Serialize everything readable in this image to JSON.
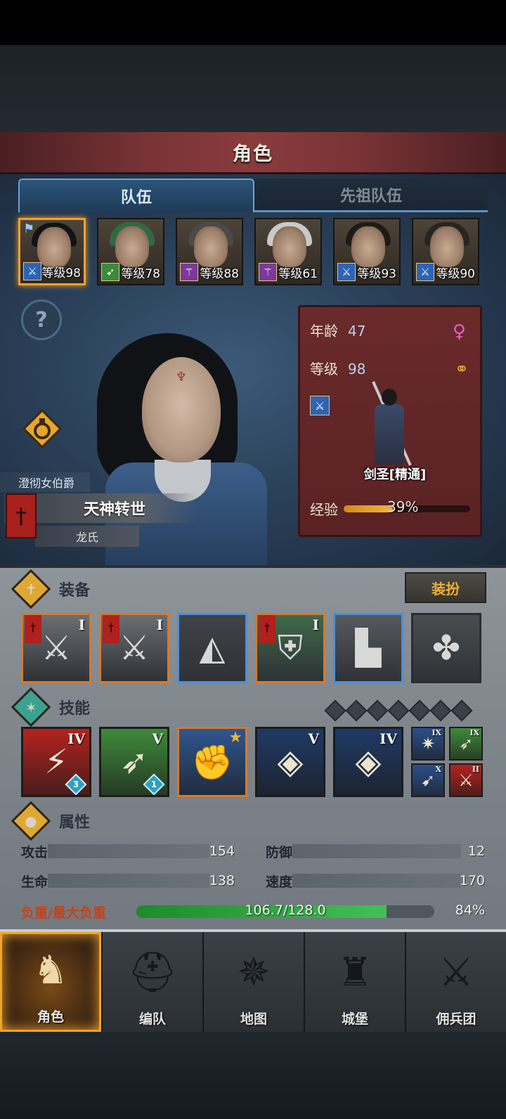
{
  "header": {
    "title": "角色"
  },
  "tabs": [
    {
      "label": "队伍",
      "active": true
    },
    {
      "label": "先祖队伍",
      "active": false
    }
  ],
  "party": [
    {
      "level": "等级98",
      "class_icon": "sword-class-icon",
      "class_color": "#2c64b5",
      "hair": "#121316",
      "selected": true
    },
    {
      "level": "等级78",
      "class_icon": "bow-class-icon",
      "class_color": "#3a8a3a",
      "hair": "#2f6a45",
      "selected": false
    },
    {
      "level": "等级88",
      "class_icon": "staff-class-icon",
      "class_color": "#7a3a9a",
      "hair": "#4a4a48",
      "selected": false
    },
    {
      "level": "等级61",
      "class_icon": "staff-class-icon",
      "class_color": "#7a3a9a",
      "hair": "#c9c9c9",
      "selected": false
    },
    {
      "level": "等级93",
      "class_icon": "sword-class-icon",
      "class_color": "#2c64b5",
      "hair": "#1e1a18",
      "selected": false
    },
    {
      "level": "等级90",
      "class_icon": "sword-class-icon",
      "class_color": "#2c64b5",
      "hair": "#2a2420",
      "selected": false
    }
  ],
  "character": {
    "title_small": "澄彻女伯爵",
    "title_main": "天神转世",
    "title_sub": "龙氏",
    "age_label": "年龄",
    "age": "47",
    "level_label": "等级",
    "level": "98",
    "class_name": "剑圣[精通]",
    "exp_label": "经验",
    "exp_percent_text": "39%",
    "exp_fraction": 0.39
  },
  "equipment": {
    "label": "装备",
    "dress_button": "装扮",
    "slots": [
      {
        "name": "halberd-weapon",
        "tier": "I",
        "banner": true,
        "rarity": "orange",
        "glyph": "⚔",
        "bg": "#6b6f74"
      },
      {
        "name": "halberd-weapon",
        "tier": "I",
        "banner": true,
        "rarity": "orange",
        "glyph": "⚔",
        "bg": "#6b6f74"
      },
      {
        "name": "hood-armor",
        "tier": "",
        "banner": false,
        "rarity": "blue",
        "glyph": "◭",
        "bg": "#3f4347"
      },
      {
        "name": "chest-armor",
        "tier": "I",
        "banner": true,
        "rarity": "orange",
        "glyph": "⛨",
        "bg": "#3e6a4a"
      },
      {
        "name": "boots-armor",
        "tier": "",
        "banner": false,
        "rarity": "blue",
        "glyph": "▙",
        "bg": "#565a5e"
      },
      {
        "name": "knot-accessory",
        "tier": "",
        "banner": false,
        "rarity": "gray",
        "glyph": "✤",
        "bg": "#4a4d50"
      }
    ]
  },
  "skills": {
    "label": "技能",
    "main": [
      {
        "tier": "IV",
        "badge": "3",
        "star": false,
        "bg": "#b4231e",
        "glyph": "⚡",
        "orange": false
      },
      {
        "tier": "V",
        "badge": "1",
        "star": false,
        "bg": "#3f8a3a",
        "glyph": "➶",
        "orange": false
      },
      {
        "tier": "",
        "badge": "",
        "star": true,
        "bg": "#2f5690",
        "glyph": "✊",
        "orange": true
      },
      {
        "tier": "V",
        "badge": "",
        "star": false,
        "bg": "#1f3a66",
        "glyph": "◈",
        "orange": false
      },
      {
        "tier": "IV",
        "badge": "",
        "star": false,
        "bg": "#1f3a66",
        "glyph": "◈",
        "orange": false
      }
    ],
    "passive": [
      {
        "tier": "IX",
        "bg": "#2a4f8a",
        "glyph": "✷"
      },
      {
        "tier": "IX",
        "bg": "#3f8a3a",
        "glyph": "➶"
      },
      {
        "tier": "X",
        "bg": "#2a4f8a",
        "glyph": "➹"
      },
      {
        "tier": "II",
        "bg": "#b4231e",
        "glyph": "⚔"
      }
    ],
    "empty_slots": 7
  },
  "attributes": {
    "label": "属性",
    "attack_label": "攻击",
    "attack": "154",
    "defense_label": "防御",
    "defense": "12",
    "hp_label": "生命",
    "hp": "138",
    "speed_label": "速度",
    "speed": "170",
    "load_label": "负重/最大负重",
    "load_text": "106.7/128.0",
    "load_percent_text": "84%",
    "load_fraction": 0.84
  },
  "nav": [
    {
      "label": "角色",
      "icon": "knight-icon",
      "glyph": "♞",
      "active": true
    },
    {
      "label": "编队",
      "icon": "helmet-icon",
      "glyph": "⛑",
      "active": false
    },
    {
      "label": "地图",
      "icon": "compass-map-icon",
      "glyph": "✵",
      "active": false
    },
    {
      "label": "城堡",
      "icon": "castle-icon",
      "glyph": "♜",
      "active": false
    },
    {
      "label": "佣兵团",
      "icon": "mercenary-icon",
      "glyph": "⚔",
      "active": false
    }
  ]
}
